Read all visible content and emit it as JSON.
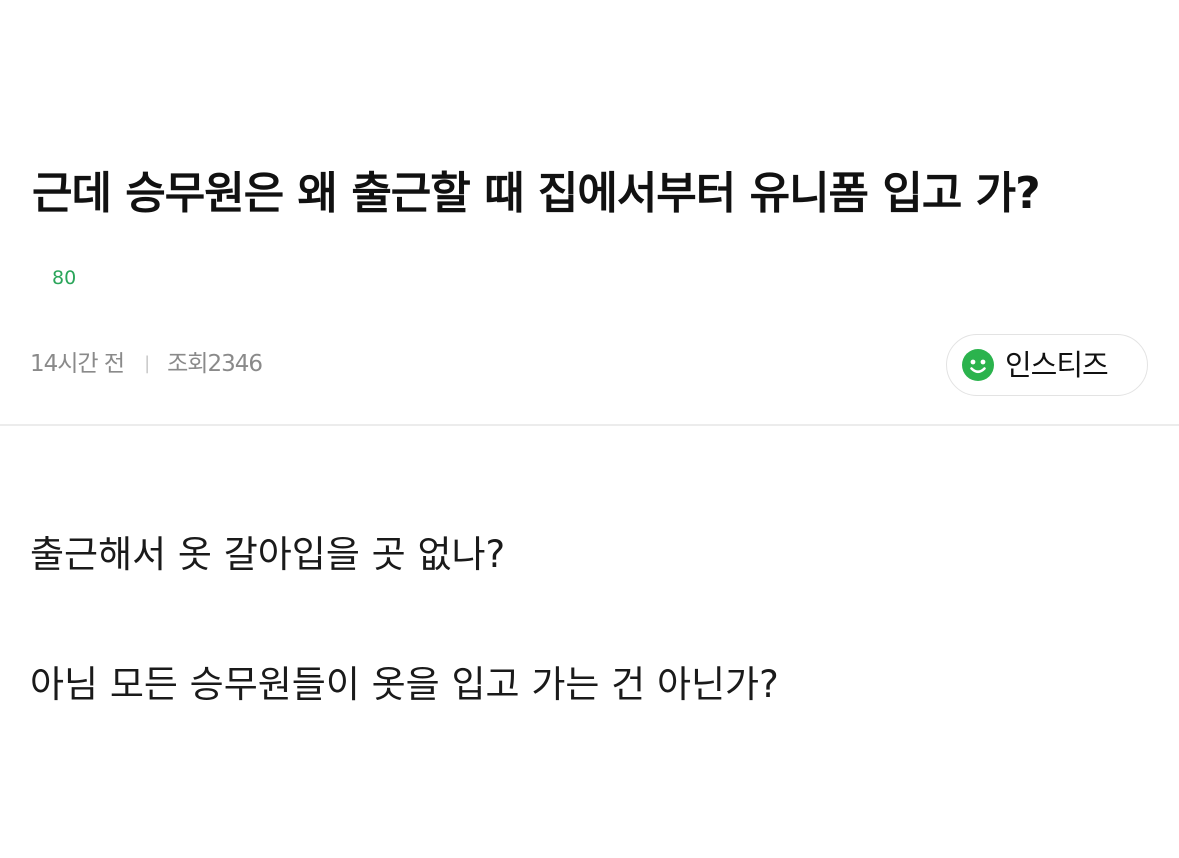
{
  "post": {
    "title": "근데 승무원은 왜 출근할 때 집에서부터 유니폼 입고 가?",
    "category_tag": "80",
    "posted_time": "14시간 전",
    "meta_separator": "|",
    "views_label": "조회",
    "views_count": "2346",
    "community": {
      "name": "인스티즈",
      "icon": "smiley-icon",
      "icon_color": "#2bb34d"
    },
    "body_lines": [
      "출근해서 옷 갈아입을 곳 없나?",
      "아님 모든 승무원들이 옷을 입고 가는 건 아닌가?"
    ]
  },
  "colors": {
    "accent_green": "#2aa55a",
    "meta_gray": "#8a8a8a",
    "divider": "#ececec"
  }
}
